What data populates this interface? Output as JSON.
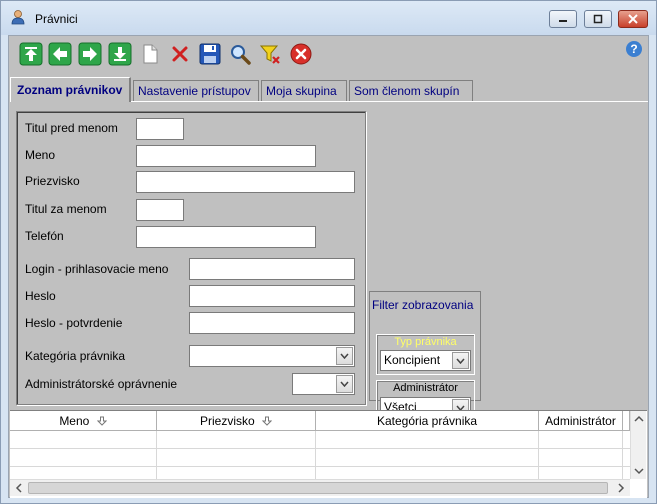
{
  "window": {
    "title": "Právnici"
  },
  "tabs": [
    {
      "label": "Zoznam právnikov"
    },
    {
      "label": "Nastavenie prístupov"
    },
    {
      "label": "Moja skupina"
    },
    {
      "label": "Som členom skupín"
    }
  ],
  "form": {
    "title_before_label": "Titul pred menom",
    "first_name_label": "Meno",
    "last_name_label": "Priezvisko",
    "title_after_label": "Titul za menom",
    "phone_label": "Telefón",
    "login_label": "Login - prihlasovacie meno",
    "password_label": "Heslo",
    "password_confirm_label": "Heslo - potvrdenie",
    "category_label": "Kategória právnika",
    "admin_right_label": "Administrátorské oprávnenie",
    "title_before_value": "",
    "first_name_value": "",
    "last_name_value": "",
    "title_after_value": "",
    "phone_value": "",
    "login_value": "",
    "password_value": "",
    "password_confirm_value": "",
    "category_value": "",
    "admin_right_value": ""
  },
  "filter": {
    "title": "Filter zobrazovania",
    "type_caption": "Typ právnika",
    "type_value": "Koncipient",
    "admin_caption": "Administrátor",
    "admin_value": "Všetci"
  },
  "grid": {
    "columns": [
      "Meno",
      "Priezvisko",
      "Kategória právnika",
      "Administrátor"
    ]
  },
  "colors": {
    "tab_text": "#000080",
    "filter_type_caption": "#ffff66"
  }
}
